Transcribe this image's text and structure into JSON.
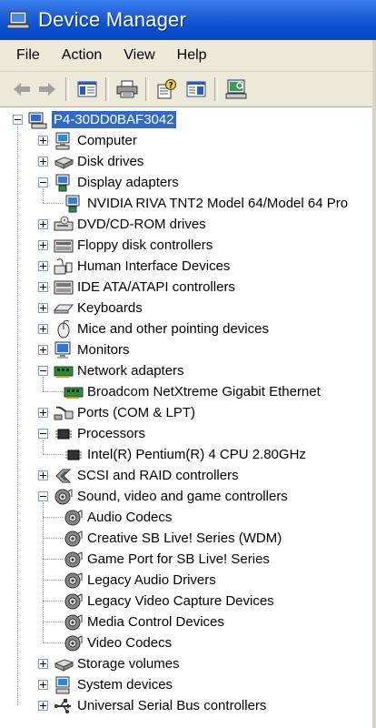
{
  "window": {
    "title": "Device Manager"
  },
  "menu": [
    "File",
    "Action",
    "View",
    "Help"
  ],
  "toolbar": {
    "buttons": [
      "back-icon",
      "forward-icon",
      "show-hide-console-tree-icon",
      "print-icon",
      "help-properties-icon",
      "view-icon",
      "scan-hardware-icon"
    ]
  },
  "tree": {
    "root": "P4-30DD0BAF3042",
    "items": [
      {
        "label": "Computer",
        "icon": "computer-icon",
        "expanded": false
      },
      {
        "label": "Disk drives",
        "icon": "disk-drive-icon",
        "expanded": false
      },
      {
        "label": "Display adapters",
        "icon": "display-adapter-icon",
        "expanded": true,
        "children": [
          "NVIDIA RIVA TNT2 Model 64/Model 64 Pro"
        ]
      },
      {
        "label": "DVD/CD-ROM drives",
        "icon": "cdrom-icon",
        "expanded": false
      },
      {
        "label": "Floppy disk controllers",
        "icon": "floppy-controller-icon",
        "expanded": false
      },
      {
        "label": "Human Interface Devices",
        "icon": "hid-icon",
        "expanded": false
      },
      {
        "label": "IDE ATA/ATAPI controllers",
        "icon": "ide-controller-icon",
        "expanded": false
      },
      {
        "label": "Keyboards",
        "icon": "keyboard-icon",
        "expanded": false
      },
      {
        "label": "Mice and other pointing devices",
        "icon": "mouse-icon",
        "expanded": false
      },
      {
        "label": "Monitors",
        "icon": "monitor-icon",
        "expanded": false
      },
      {
        "label": "Network adapters",
        "icon": "network-adapter-icon",
        "expanded": true,
        "children": [
          "Broadcom NetXtreme Gigabit Ethernet"
        ]
      },
      {
        "label": "Ports (COM & LPT)",
        "icon": "port-icon",
        "expanded": false
      },
      {
        "label": "Processors",
        "icon": "processor-icon",
        "expanded": true,
        "children": [
          "Intel(R) Pentium(R) 4 CPU 2.80GHz"
        ]
      },
      {
        "label": "SCSI and RAID controllers",
        "icon": "scsi-icon",
        "expanded": false
      },
      {
        "label": "Sound, video and game controllers",
        "icon": "sound-icon",
        "expanded": true,
        "children": [
          "Audio Codecs",
          "Creative SB Live! Series (WDM)",
          "Game Port for SB Live! Series",
          "Legacy Audio Drivers",
          "Legacy Video Capture Devices",
          "Media Control Devices",
          "Video Codecs"
        ]
      },
      {
        "label": "Storage volumes",
        "icon": "storage-volume-icon",
        "expanded": false
      },
      {
        "label": "System devices",
        "icon": "system-device-icon",
        "expanded": false
      },
      {
        "label": "Universal Serial Bus controllers",
        "icon": "usb-icon",
        "expanded": false
      }
    ]
  },
  "colors": {
    "titlebar": "#0a4fcf",
    "selection": "#316ac5",
    "chrome": "#ece9d8"
  }
}
